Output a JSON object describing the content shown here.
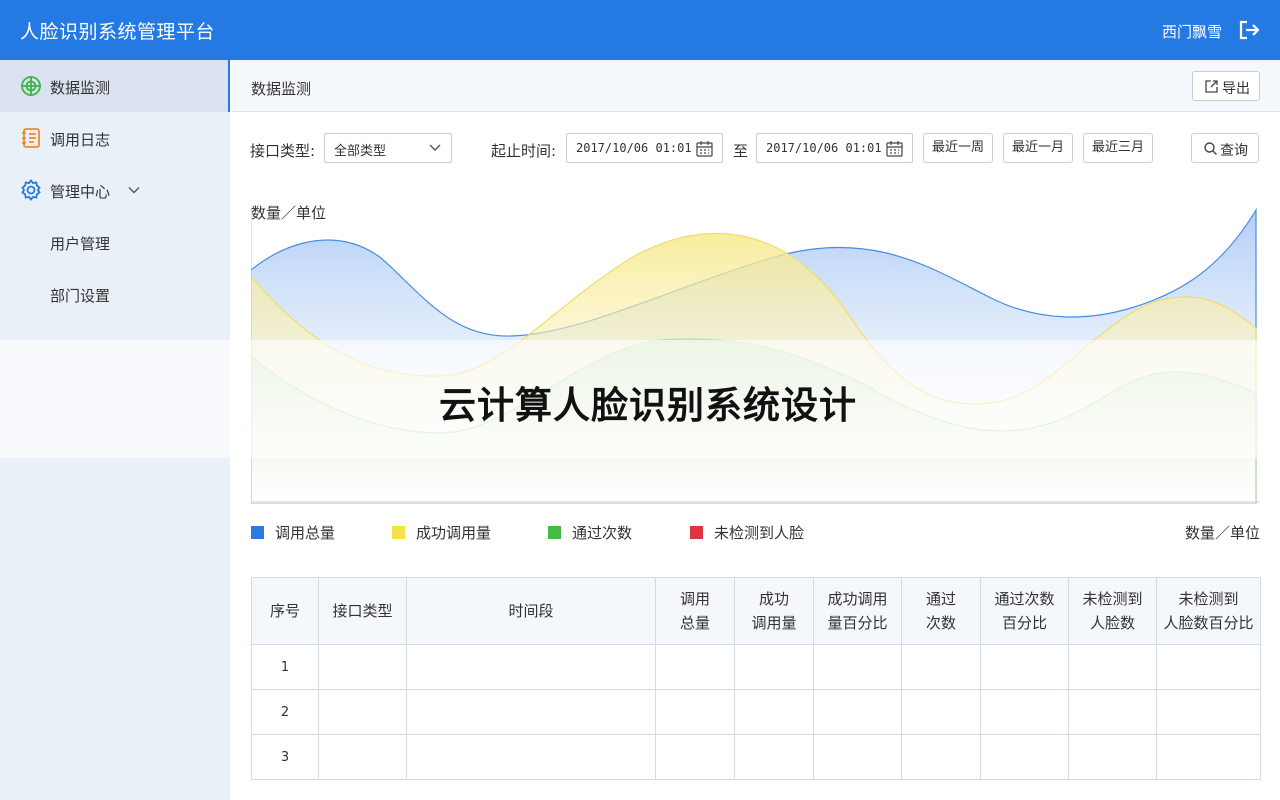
{
  "app": {
    "title": "人脸识别系统管理平台",
    "user": "西门飘雪",
    "logout_icon": "logout-icon"
  },
  "sidebar": {
    "items": [
      {
        "label": "数据监测",
        "icon": "radar-icon"
      },
      {
        "label": "调用日志",
        "icon": "notebook-icon"
      },
      {
        "label": "管理中心",
        "icon": "gear-icon"
      },
      {
        "label": "用户管理"
      },
      {
        "label": "部门设置"
      }
    ]
  },
  "page": {
    "breadcrumb": "数据监测",
    "export_label": "导出"
  },
  "filters": {
    "type_label": "接口类型:",
    "type_value": "全部类型",
    "time_label": "起止时间:",
    "start": "2017/10/06 01:01",
    "to": "至",
    "end": "2017/10/06 01:01",
    "week": "最近一周",
    "month": "最近一月",
    "quarter": "最近三月",
    "search": "查询"
  },
  "chart_data": {
    "type": "area",
    "ylabel": "数量／单位",
    "unit_right": "数量／单位",
    "series": [
      {
        "name": "调用总量",
        "color": "#2a7ae2",
        "fill": "#a9c8f3"
      },
      {
        "name": "成功调用量",
        "color": "#f5e04a",
        "fill": "#f7ea96"
      },
      {
        "name": "通过次数",
        "color": "#44bb44",
        "fill": "#c6e3b8"
      },
      {
        "name": "未检测到人脸",
        "color": "#e03344",
        "fill": "#f1a5ad"
      }
    ]
  },
  "watermark": "云计算人脸识别系统设计",
  "table": {
    "headers": [
      "序号",
      "接口类型",
      "时间段",
      "调用\n总量",
      "成功\n调用量",
      "成功调用\n量百分比",
      "通过\n次数",
      "通过次数\n百分比",
      "未检测到\n人脸数",
      "未检测到\n人脸数百分比"
    ],
    "rows": [
      [
        "1",
        "",
        "",
        "",
        "",
        "",
        "",
        "",
        "",
        ""
      ],
      [
        "2",
        "",
        "",
        "",
        "",
        "",
        "",
        "",
        "",
        ""
      ],
      [
        "3",
        "",
        "",
        "",
        "",
        "",
        "",
        "",
        "",
        ""
      ]
    ]
  }
}
